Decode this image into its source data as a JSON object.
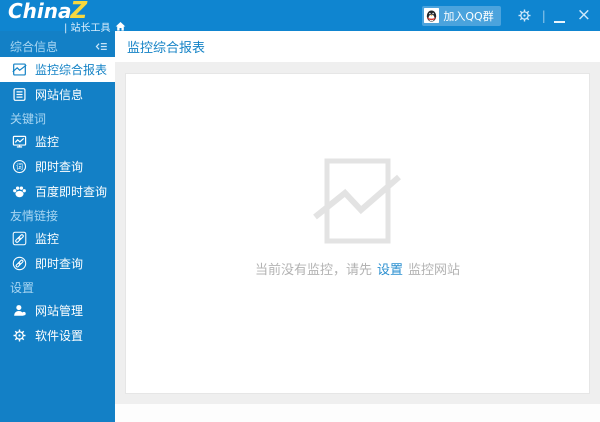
{
  "titlebar": {
    "logo_part1": "China",
    "logo_part2": "Z",
    "subtitle": "| 站长工具",
    "qq_label": "加入QQ群",
    "separator": "|",
    "close_glyph": "×"
  },
  "sidebar": {
    "word_icon_glyph": "词",
    "sections": [
      {
        "label": "综合信息",
        "items": [
          {
            "label": "监控综合报表",
            "icon": "chart-icon",
            "selected": true
          },
          {
            "label": "网站信息",
            "icon": "document-icon",
            "selected": false
          }
        ]
      },
      {
        "label": "关键词",
        "items": [
          {
            "label": "监控",
            "icon": "monitor-icon",
            "selected": false
          },
          {
            "label": "即时查询",
            "icon": "word-circle-icon",
            "selected": false
          },
          {
            "label": "百度即时查询",
            "icon": "baidu-paw-icon",
            "selected": false
          }
        ]
      },
      {
        "label": "友情链接",
        "items": [
          {
            "label": "监控",
            "icon": "link-square-icon",
            "selected": false
          },
          {
            "label": "即时查询",
            "icon": "link-circle-icon",
            "selected": false
          }
        ]
      },
      {
        "label": "设置",
        "items": [
          {
            "label": "网站管理",
            "icon": "user-icon",
            "selected": false
          },
          {
            "label": "软件设置",
            "icon": "gear-icon",
            "selected": false
          }
        ]
      }
    ]
  },
  "main": {
    "header_title": "监控综合报表",
    "empty": {
      "text_before": "当前没有监控，请先",
      "link_label": "设置",
      "text_after": "监控网站"
    }
  },
  "colors": {
    "titlebar_blue": "#0f85d0",
    "sidebar_blue": "#1380c6",
    "accent_blue": "#1583c6",
    "link_blue": "#2a8fd0",
    "qq_badge_blue": "#4ba3dd",
    "logo_yellow": "#f7d83e",
    "section_label_blue": "#a9d6f2",
    "content_gray": "#efefef",
    "empty_icon_gray": "#e3e3e3",
    "empty_text_gray": "#b3b3b3"
  }
}
